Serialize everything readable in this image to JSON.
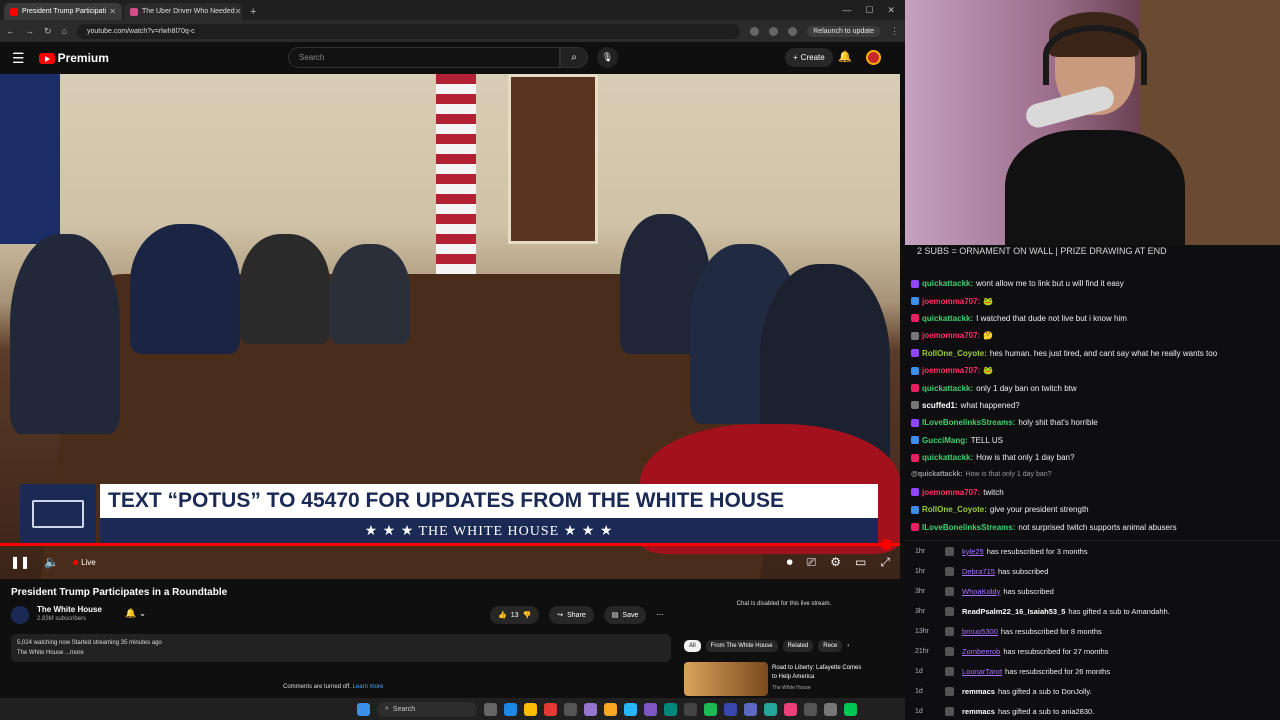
{
  "browser": {
    "tabs": [
      {
        "label": "President Trump Participati",
        "active": true
      },
      {
        "label": "The Uber Driver Who Needed",
        "active": false
      }
    ],
    "url": "youtube.com/watch?v=rlwh8l70q-c",
    "relaunch_label": "Relaunch to update"
  },
  "youtube": {
    "brand": "Premium",
    "search_placeholder": "Search",
    "create_label": "Create"
  },
  "video": {
    "lower_third_headline": "TEXT “POTUS” TO 45470 FOR UPDATES FROM THE WHITE HOUSE",
    "lower_third_sub": "★ ★ ★   THE WHITE HOUSE   ★ ★ ★",
    "live_label": "Live",
    "title": "President Trump Participates in a Roundtable",
    "channel_name": "The White House",
    "channel_subs": "2.83M subscribers",
    "like_count": "13",
    "share_label": "Share",
    "save_label": "Save",
    "description_line1": "5,024 watching now  Started streaming 35 minutes ago",
    "description_line2": "The White House ...more",
    "comments_off": "Comments are turned off.",
    "learn_more": "Learn more",
    "chat_disabled": "Chat is disabled for this live stream."
  },
  "related": {
    "chips": [
      {
        "label": "All",
        "active": true
      },
      {
        "label": "From The White House",
        "active": false
      },
      {
        "label": "Related",
        "active": false
      },
      {
        "label": "Rece",
        "active": false
      }
    ],
    "item_title": "Road to Liberty: Lafayette Comes to Help America",
    "item_channel": "The White House"
  },
  "taskbar": {
    "search_label": "Search"
  },
  "twitch": {
    "banner": "2 SUBS = ORNAMENT ON WALL | PRIZE DRAWING AT END",
    "messages": [
      {
        "user": "quickattackk:",
        "text": "wont allow me to link but u will find it easy",
        "color": "#3bd16f"
      },
      {
        "user": "joemomma707:",
        "text": "🐸",
        "color": "#ff2e6a"
      },
      {
        "user": "quickattackk:",
        "text": "I watched that dude not live but i know him",
        "color": "#3bd16f"
      },
      {
        "user": "joemomma707:",
        "text": "🤔",
        "color": "#ff2e6a"
      },
      {
        "user": "RollOne_Coyote:",
        "text": "hes human. hes just tired, and cant say what he really wants too",
        "color": "#9acd32"
      },
      {
        "user": "joemomma707:",
        "text": "🐸",
        "color": "#ff2e6a"
      },
      {
        "user": "quickattackk:",
        "text": "only 1 day ban on twitch btw",
        "color": "#3bd16f"
      },
      {
        "user": "scuffed1:",
        "text": "what happened?",
        "color": "#ffffff"
      },
      {
        "user": "ILoveBonelinksStreams:",
        "text": "holy shit that's horrible",
        "color": "#3bd16f"
      },
      {
        "user": "GucciMang:",
        "text": "TELL US",
        "color": "#3bd16f"
      },
      {
        "user": "quickattackk:",
        "text": "How is that only 1 day ban?",
        "color": "#3bd16f"
      },
      {
        "user": "@quickattackk:",
        "text": "How is that only 1 day ban?",
        "color": "#9b9b9b",
        "reply": true
      },
      {
        "user": "joemomma707:",
        "text": "twitch",
        "color": "#ff2e6a"
      },
      {
        "user": "RollOne_Coyote:",
        "text": "give your president strength",
        "color": "#9acd32"
      },
      {
        "user": "ILoveBonelinksStreams:",
        "text": "not surprised twitch supports animal abusers",
        "color": "#3bd16f"
      }
    ],
    "events": [
      {
        "time": "1hr",
        "user": "kyle25",
        "text": "has resubscribed for 3 months",
        "underline": true
      },
      {
        "time": "1hr",
        "user": "Debra715",
        "text": "has subscribed",
        "underline": true
      },
      {
        "time": "3hr",
        "user": "WhoaKoldy",
        "text": "has subscribed",
        "underline": true
      },
      {
        "time": "3hr",
        "user": "ReadPsalm22_16_Isaiah53_5",
        "text": "has gifted a sub to Amandahh.",
        "underline": false
      },
      {
        "time": "13hr",
        "user": "brnuo5300",
        "text": "has resubscribed for 8 months",
        "underline": true
      },
      {
        "time": "21hr",
        "user": "Zombeerob",
        "text": "has resubscribed for 27 months",
        "underline": true
      },
      {
        "time": "1d",
        "user": "LoonarTarot",
        "text": "has resubscribed for 26 months",
        "underline": true
      },
      {
        "time": "1d",
        "user": "remmacs",
        "text": "has gifted a sub to DonJolly.",
        "underline": false
      },
      {
        "time": "1d",
        "user": "remmacs",
        "text": "has gifted a sub to ania2830.",
        "underline": false
      }
    ]
  }
}
